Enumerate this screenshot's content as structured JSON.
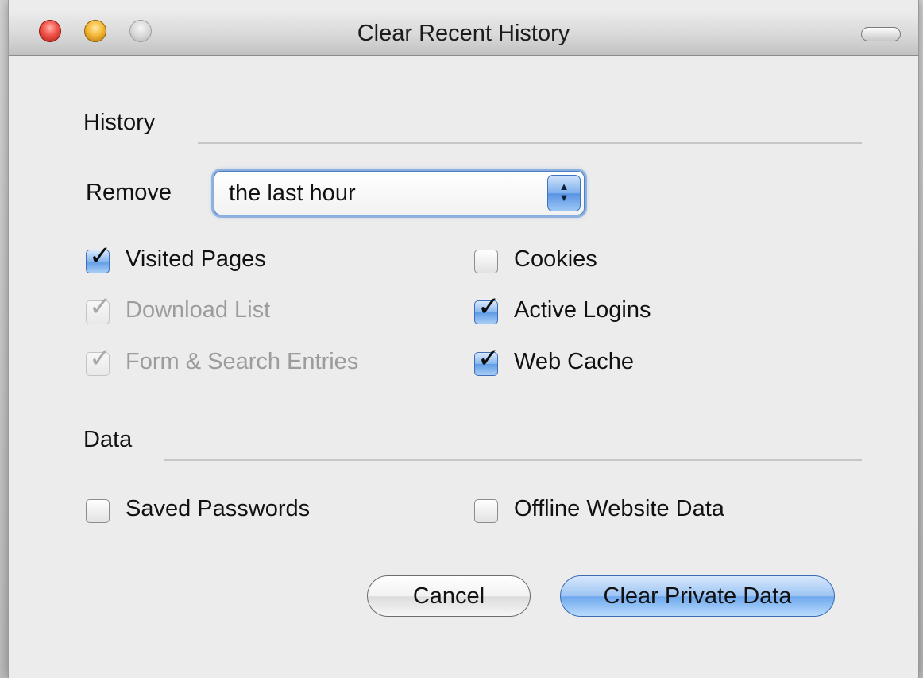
{
  "window": {
    "title": "Clear Recent History"
  },
  "history": {
    "section_label": "History",
    "remove_label": "Remove",
    "remove_selected": "the last hour",
    "options": [
      {
        "label": "Visited Pages",
        "checked": true,
        "disabled": false
      },
      {
        "label": "Download List",
        "checked": true,
        "disabled": true
      },
      {
        "label": "Form & Search Entries",
        "checked": true,
        "disabled": true
      },
      {
        "label": "Cookies",
        "checked": false,
        "disabled": false
      },
      {
        "label": "Active Logins",
        "checked": true,
        "disabled": false
      },
      {
        "label": "Web Cache",
        "checked": true,
        "disabled": false
      }
    ]
  },
  "data": {
    "section_label": "Data",
    "options": [
      {
        "label": "Saved Passwords",
        "checked": false,
        "disabled": false
      },
      {
        "label": "Offline Website Data",
        "checked": false,
        "disabled": false
      }
    ]
  },
  "buttons": {
    "cancel": "Cancel",
    "clear": "Clear Private Data"
  },
  "colors": {
    "accent": "#5f9be6",
    "window_bg": "#ececec",
    "disabled_text": "#9c9c9c"
  }
}
